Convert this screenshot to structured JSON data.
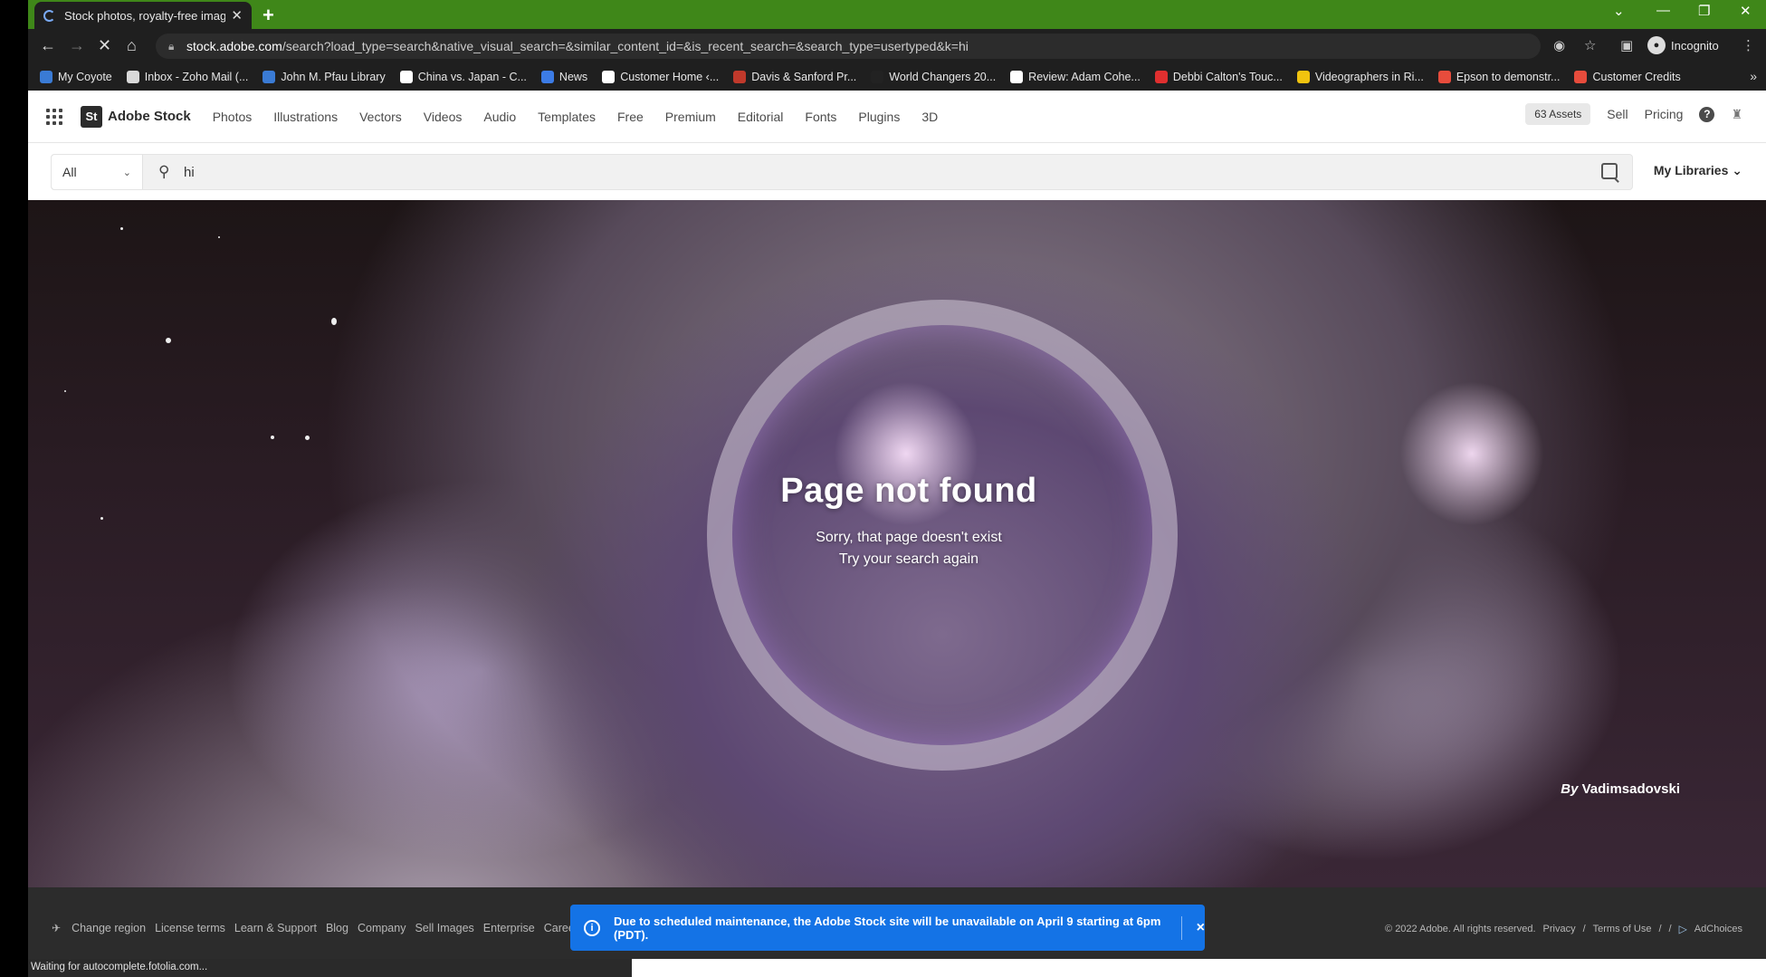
{
  "browser": {
    "tab_title": "Stock photos, royalty-free image",
    "new_tab_label": "+",
    "url_host": "stock.adobe.com",
    "url_path": "/search?load_type=search&native_visual_search=&similar_content_id=&is_recent_search=&search_type=usertyped&k=hi",
    "incognito_label": "Incognito",
    "status_text": "Waiting for autocomplete.fotolia.com...",
    "bookmarks": [
      {
        "label": "My Coyote",
        "color": "#3a7bd5"
      },
      {
        "label": "Inbox - Zoho Mail (...",
        "color": "#d9d9d9"
      },
      {
        "label": "John M. Pfau Library",
        "color": "#3a7bd5"
      },
      {
        "label": "China vs. Japan - C...",
        "color": "#ffffff"
      },
      {
        "label": "News",
        "color": "#3c7ce6"
      },
      {
        "label": "Customer Home ‹...",
        "color": "#ffffff"
      },
      {
        "label": "Davis & Sanford Pr...",
        "color": "#c0392b"
      },
      {
        "label": "World Changers 20...",
        "color": "#222222"
      },
      {
        "label": "Review: Adam Cohe...",
        "color": "#ffffff"
      },
      {
        "label": "Debbi Calton's Touc...",
        "color": "#e02f2f"
      },
      {
        "label": "Videographers in Ri...",
        "color": "#f1c40f"
      },
      {
        "label": "Epson to demonstr...",
        "color": "#e74c3c"
      },
      {
        "label": "Customer Credits",
        "color": "#e74c3c"
      }
    ]
  },
  "header": {
    "logo_text": "St",
    "brand": "Adobe Stock",
    "nav": [
      "Photos",
      "Illustrations",
      "Vectors",
      "Videos",
      "Audio",
      "Templates",
      "Free",
      "Premium",
      "Editorial",
      "Fonts",
      "Plugins",
      "3D"
    ],
    "assets_badge": "63 Assets",
    "sell": "Sell",
    "pricing": "Pricing",
    "help_glyph": "?"
  },
  "search": {
    "filter_value": "All",
    "query": "hi",
    "my_libraries": "My Libraries"
  },
  "hero": {
    "title": "Page not found",
    "line1": "Sorry, that page doesn't exist",
    "line2": "Try your search again",
    "credit_by": "By",
    "credit_name": "Vadimsadovski"
  },
  "footer": {
    "links": [
      "Change region",
      "License terms",
      "Learn & Support",
      "Blog",
      "Company",
      "Sell Images",
      "Enterprise",
      "Careers"
    ],
    "copyright": "© 2022 Adobe. All rights reserved.",
    "privacy": "Privacy",
    "terms": "Terms of Use",
    "adchoices": "AdChoices"
  },
  "banner": {
    "message": "Due to scheduled maintenance, the Adobe Stock site will be unavailable on April 9 starting at 6pm (PDT).",
    "close": "×",
    "info_glyph": "i"
  },
  "colors": {
    "tabbar": "#3f8719",
    "banner": "#1473e6",
    "footer": "#2c2c2c"
  }
}
